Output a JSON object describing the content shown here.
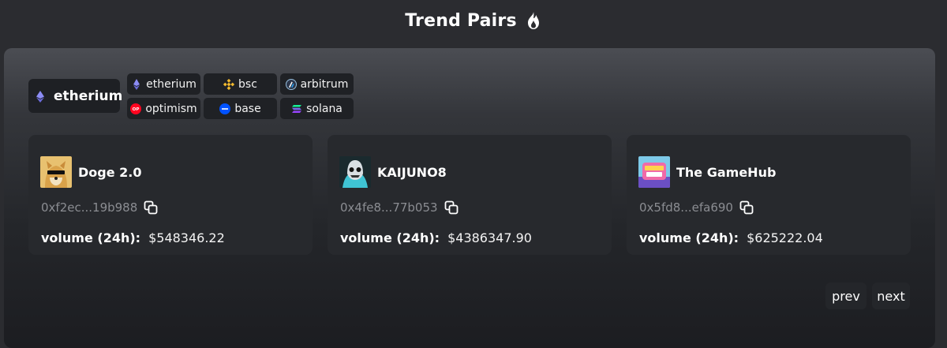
{
  "header": {
    "title": "Trend Pairs",
    "title_icon": "fire-icon"
  },
  "chain_selector": {
    "selected": {
      "label": "etherium",
      "icon": "ethereum-icon"
    },
    "options": [
      {
        "label": "etherium",
        "icon": "ethereum-icon",
        "color": "#8c8cf5"
      },
      {
        "label": "bsc",
        "icon": "bnb-icon",
        "color": "#f3ba2f"
      },
      {
        "label": "arbitrum",
        "icon": "arbitrum-icon",
        "color": "#28a0f0"
      },
      {
        "label": "optimism",
        "icon": "optimism-icon",
        "color": "#ff0420"
      },
      {
        "label": "base",
        "icon": "base-icon",
        "color": "#0052ff"
      },
      {
        "label": "solana",
        "icon": "solana-icon",
        "color": "#9945ff"
      }
    ]
  },
  "cards": [
    {
      "name": "Doge 2.0",
      "address": "0xf2ec...19b988",
      "volume_label": "volume (24h):",
      "volume": "$548346.22"
    },
    {
      "name": "KAIJUNO8",
      "address": "0x4fe8...77b053",
      "volume_label": "volume (24h):",
      "volume": "$4386347.90"
    },
    {
      "name": "The GameHub",
      "address": "0x5fd8...efa690",
      "volume_label": "volume (24h):",
      "volume": "$625222.04"
    }
  ],
  "pagination": {
    "prev_label": "prev",
    "next_label": "next"
  },
  "colors": {
    "background": "#2b2c30",
    "card": "#27292d",
    "muted_text": "#8b8d92"
  }
}
